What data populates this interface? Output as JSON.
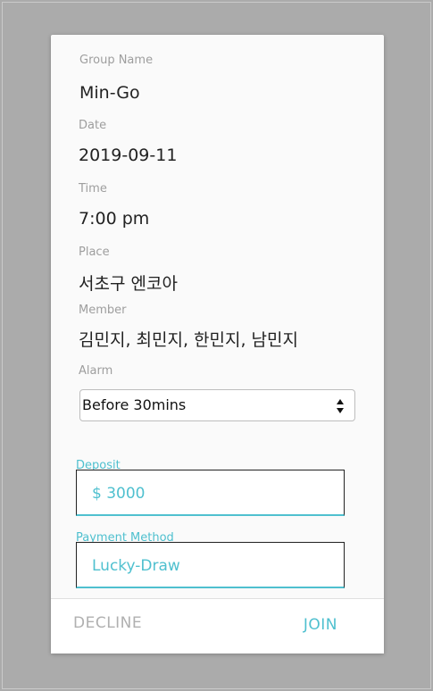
{
  "form": {
    "group_name_label": "Group Name",
    "group_name_value": "Min-Go",
    "date_label": "Date",
    "date_value": "2019-09-11",
    "time_label": "Time",
    "time_value": "7:00 pm",
    "place_label": "Place",
    "place_value": "서초구 엔코아",
    "member_label": "Member",
    "member_value": "김민지, 최민지, 한민지, 남민지",
    "alarm_label": "Alarm",
    "alarm_selected": "Before 30mins",
    "deposit_label": "Deposit",
    "deposit_value": "$ 3000",
    "payment_label": "Payment Method",
    "payment_value": "Lucky-Draw"
  },
  "actions": {
    "decline_label": "DECLINE",
    "join_label": "JOIN"
  },
  "colors": {
    "accent": "#4fc0cf",
    "backdrop": "#ababab",
    "muted": "#9e9e9e"
  },
  "icons": {
    "select_arrows": "chevron-up-down-icon"
  }
}
